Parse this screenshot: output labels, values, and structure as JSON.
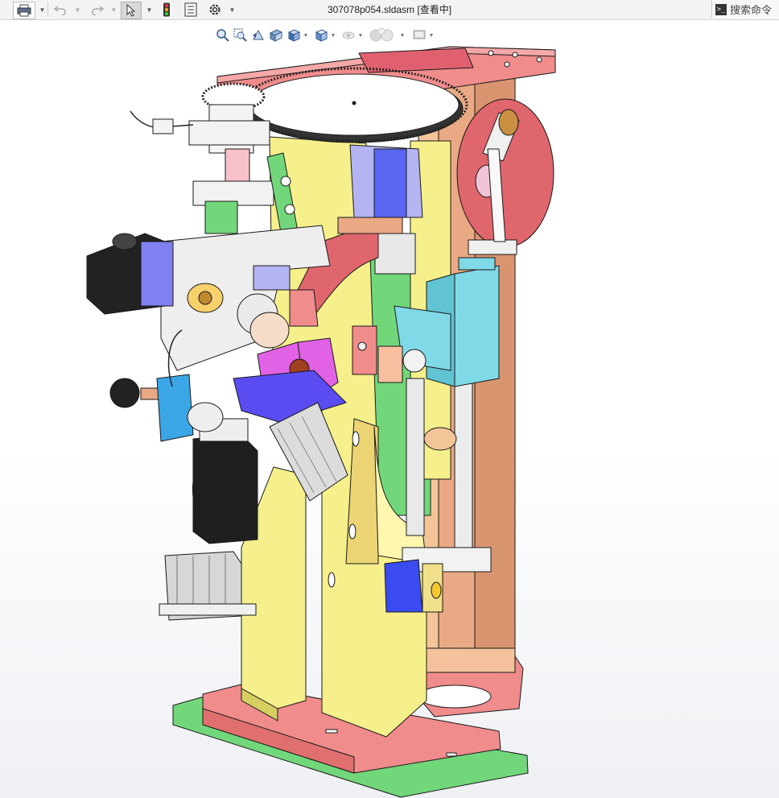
{
  "window": {
    "title": "307078p054.sldasm [查看中]"
  },
  "toolbar": {
    "items": [
      {
        "name": "print",
        "icon": "printer-icon"
      },
      {
        "name": "undo",
        "icon": "undo-icon"
      },
      {
        "name": "redo",
        "icon": "redo-icon"
      },
      {
        "name": "select",
        "icon": "select-cursor-icon"
      },
      {
        "name": "rebuild",
        "icon": "traffic-light-icon"
      },
      {
        "name": "file-properties",
        "icon": "document-list-icon"
      },
      {
        "name": "options",
        "icon": "gear-icon"
      }
    ]
  },
  "search": {
    "label": "搜索命令",
    "icon": "command-prompt-icon"
  },
  "heads_up_toolbar": {
    "items": [
      "zoom-to-fit-icon",
      "zoom-to-area-icon",
      "previous-view-icon",
      "section-view-icon",
      "view-orientation-icon",
      "display-style-icon",
      "hide-show-items-icon",
      "edit-appearance-icon",
      "apply-scene-icon",
      "view-settings-icon"
    ]
  },
  "colors": {
    "yellow": "#f5f08c",
    "pink": "#f08c8c",
    "salmon": "#e9a984",
    "green": "#72d67a",
    "cyan": "#7fd9e6",
    "blue": "#3a4cf0",
    "magenta": "#e262e6",
    "lavender": "#b4b4f2",
    "red": "#e0666e",
    "black": "#222222"
  },
  "model": {
    "name": "307078p054"
  }
}
